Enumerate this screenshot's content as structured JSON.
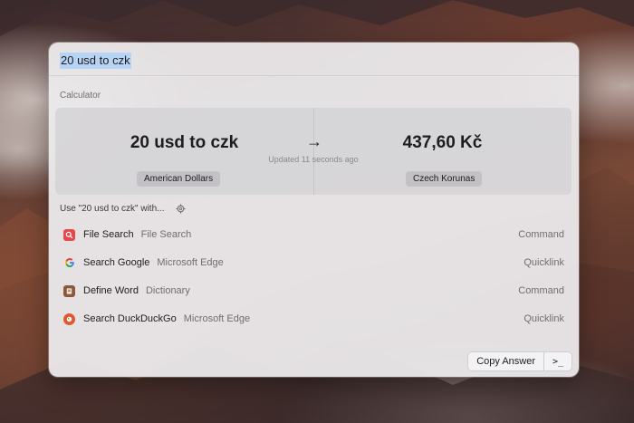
{
  "search": {
    "query": "20 usd to czk"
  },
  "calculator": {
    "section_title": "Calculator",
    "expression": "20 usd to czk",
    "result": "437,60 Kč",
    "updated": "Updated 11 seconds ago",
    "from_currency": "American Dollars",
    "to_currency": "Czech Korunas"
  },
  "use_with": {
    "label": "Use \"20 usd to czk\" with..."
  },
  "items": [
    {
      "icon": "magnifier-icon",
      "title": "File Search",
      "subtitle": "File Search",
      "type": "Command",
      "icon_color": "#e5484d"
    },
    {
      "icon": "google-icon",
      "title": "Search Google",
      "subtitle": "Microsoft Edge",
      "type": "Quicklink",
      "icon_color": "#4285f4"
    },
    {
      "icon": "dictionary-icon",
      "title": "Define Word",
      "subtitle": "Dictionary",
      "type": "Command",
      "icon_color": "#8b5a3c"
    },
    {
      "icon": "duckduckgo-icon",
      "title": "Search DuckDuckGo",
      "subtitle": "Microsoft Edge",
      "type": "Quicklink",
      "icon_color": "#de5833"
    }
  ],
  "footer": {
    "copy_label": "Copy Answer",
    "terminal_symbol": ">_"
  }
}
